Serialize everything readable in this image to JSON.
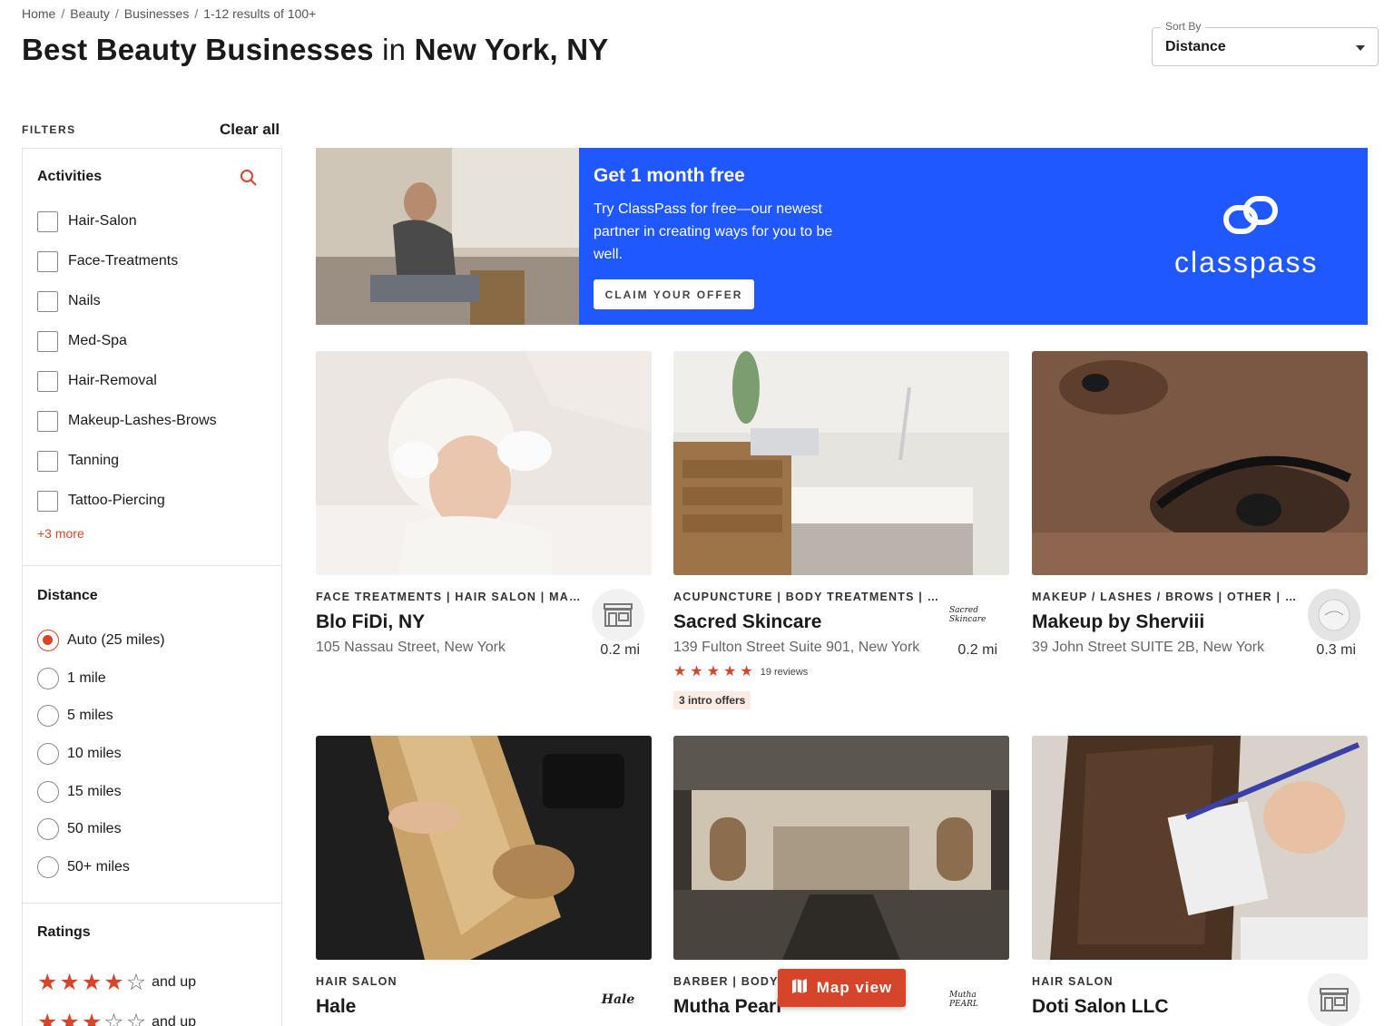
{
  "breadcrumb": [
    "Home",
    "Beauty",
    "Businesses",
    "1-12 results of 100+"
  ],
  "title": {
    "part1": "Best Beauty Businesses",
    "part2": "in",
    "part3": "New York, NY"
  },
  "sort": {
    "label": "Sort By",
    "value": "Distance"
  },
  "filters": {
    "heading": "FILTERS",
    "clear_all": "Clear all",
    "activities": {
      "title": "Activities",
      "items": [
        "Hair-Salon",
        "Face-Treatments",
        "Nails",
        "Med-Spa",
        "Hair-Removal",
        "Makeup-Lashes-Brows",
        "Tanning",
        "Tattoo-Piercing"
      ],
      "more": "+3 more"
    },
    "distance": {
      "title": "Distance",
      "items": [
        "Auto (25 miles)",
        "1 mile",
        "5 miles",
        "10 miles",
        "15 miles",
        "50 miles",
        "50+ miles"
      ],
      "selected_index": 0
    },
    "ratings": {
      "title": "Ratings",
      "items": [
        {
          "stars": 4,
          "label": "and up"
        },
        {
          "stars": 3,
          "label": "and up"
        }
      ]
    }
  },
  "promo": {
    "title": "Get 1 month free",
    "text": "Try ClassPass for free—our newest partner in creating ways for you to be well.",
    "button": "CLAIM YOUR OFFER",
    "brand": "classpass",
    "bg_color": "#2058ff"
  },
  "cards": [
    {
      "category": "FACE TREATMENTS | HAIR SALON | MAK...",
      "name": "Blo FiDi, NY",
      "address": "105 Nassau Street, New York",
      "distance": "0.2 mi"
    },
    {
      "category": "ACUPUNCTURE | BODY TREATMENTS | F...",
      "name": "Sacred Skincare",
      "address": "139 Fulton Street Suite 901, New York",
      "distance": "0.2 mi",
      "logo_text": "Sacred Skincare",
      "rating": 5,
      "reviews": "19 reviews",
      "offers": "3 intro offers"
    },
    {
      "category": "MAKEUP / LASHES / BROWS | OTHER | T...",
      "name": "Makeup by Sherviii",
      "address": "39 John Street SUITE 2B, New York",
      "distance": "0.3 mi"
    },
    {
      "category": "HAIR SALON",
      "name": "Hale",
      "logo_text": "Hale"
    },
    {
      "category": "BARBER | BODY TR...",
      "name": "Mutha Pearl",
      "logo_text": "Mutha PEARL"
    },
    {
      "category": "HAIR SALON",
      "name": "Doti Salon LLC"
    }
  ],
  "map_button": "Map view",
  "accent_color": "#d6452a"
}
